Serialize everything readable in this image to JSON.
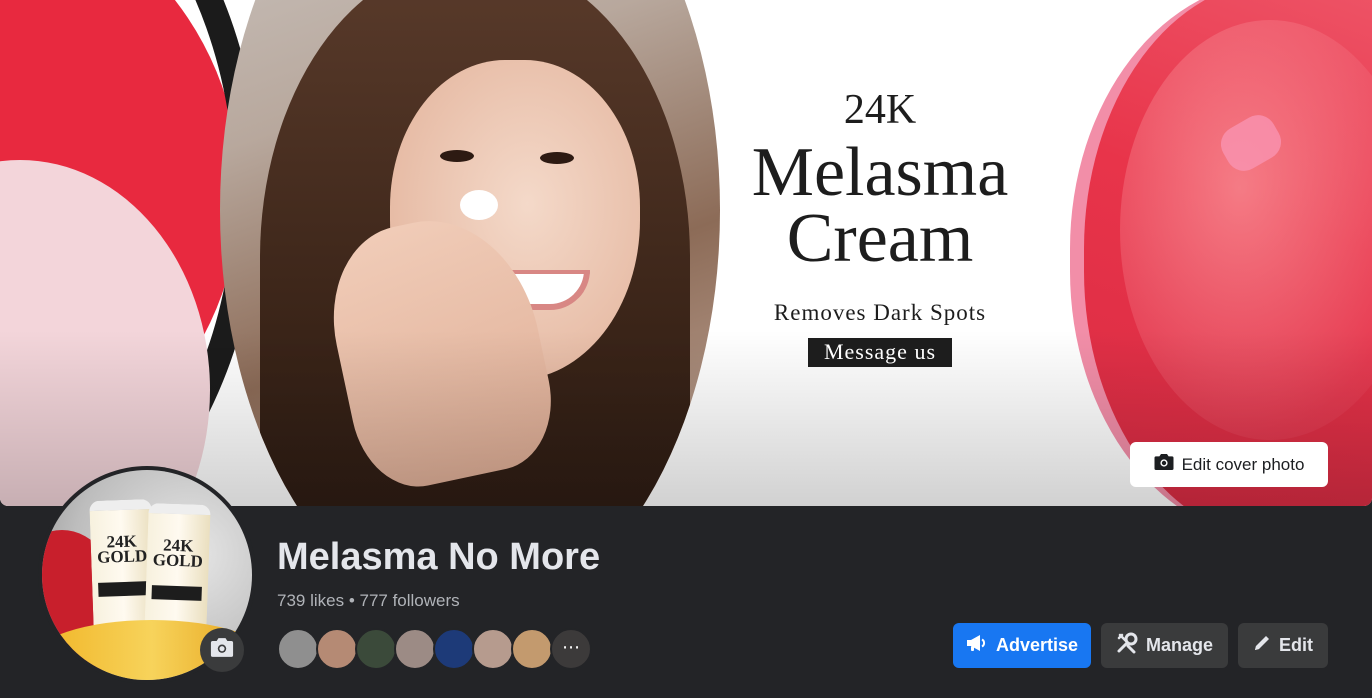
{
  "cover": {
    "headline_top": "24K",
    "headline_main": "Melasma",
    "headline_main2": "Cream",
    "headline_sub": "Removes Dark Spots",
    "headline_cta": "Message us",
    "edit_cover_label": "Edit cover photo"
  },
  "avatar": {
    "product_brand_line1": "24K",
    "product_brand_line2": "GOLD"
  },
  "page": {
    "title": "Melasma No More",
    "stats": "739 likes • 777 followers"
  },
  "followers": {
    "avatar_colors": [
      "#8f8f8f",
      "#b58a74",
      "#3b4a3a",
      "#9c8b85",
      "#1d3a78",
      "#b69b8e",
      "#c39a6e",
      "#3c3a3a"
    ],
    "more_icon": "ellipsis-icon"
  },
  "actions": {
    "advertise_label": "Advertise",
    "manage_label": "Manage",
    "edit_label": "Edit"
  },
  "colors": {
    "primary": "#1877f2",
    "background": "#232427",
    "button_secondary": "#3a3b3c"
  },
  "icons": {
    "camera": "camera-icon",
    "megaphone": "megaphone-icon",
    "tools": "tools-icon",
    "pencil": "pencil-icon"
  }
}
